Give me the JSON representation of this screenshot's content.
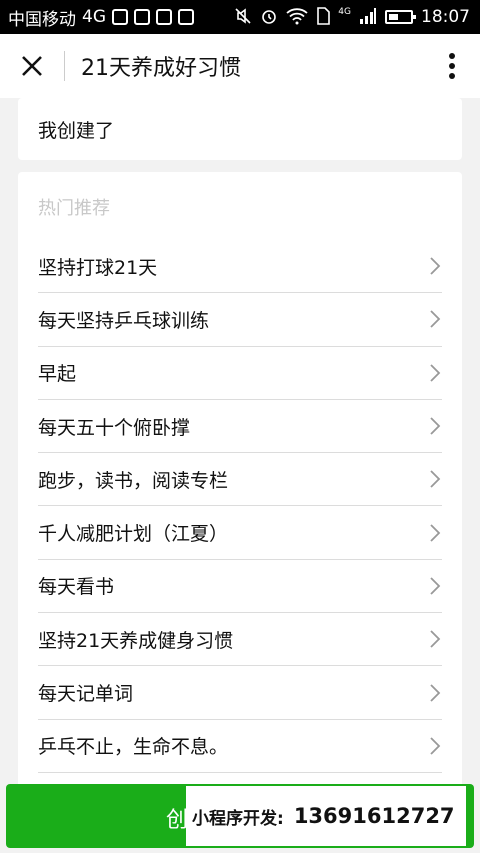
{
  "status_bar": {
    "carrier": "中国移动",
    "network": "4G",
    "network_small": "4G",
    "time": "18:07"
  },
  "navbar": {
    "title": "21天养成好习惯"
  },
  "created": {
    "label": "我创建了"
  },
  "hot": {
    "title": "热门推荐",
    "items": [
      "坚持打球21天",
      "每天坚持乒乓球训练",
      "早起",
      "每天五十个俯卧撑",
      "跑步，读书，阅读专栏",
      "千人减肥计划（江夏）",
      "每天看书",
      "坚持21天养成健身习惯",
      "每天记单词",
      "乒乓不止，生命不息。"
    ]
  },
  "bottom_button": {
    "label": "创"
  },
  "watermark": {
    "label": "小程序开发:",
    "phone": "13691612727"
  },
  "colors": {
    "primary_green": "#1aad19",
    "statusbar_bg": "#000000",
    "page_bg": "#f2f2f2"
  }
}
